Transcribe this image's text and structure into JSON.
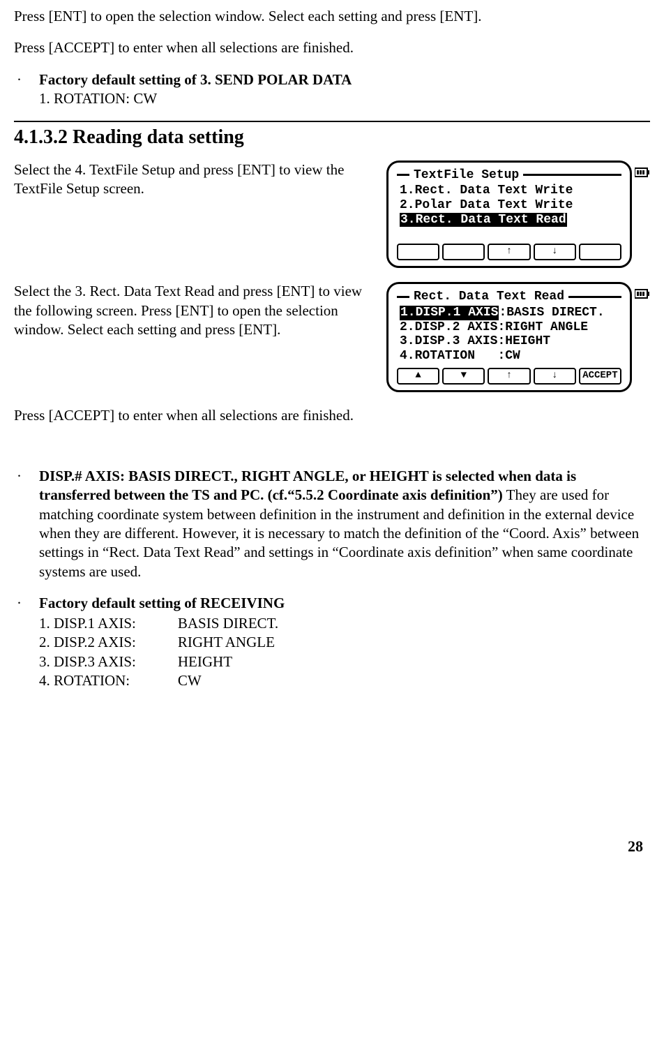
{
  "intro": {
    "p1": "Press [ENT] to open the selection window. Select each setting and press [ENT].",
    "p2": "Press [ACCEPT] to enter when all selections are finished."
  },
  "bullet1": {
    "title": "Factory default setting of 3. SEND POLAR DATA",
    "line1": "1. ROTATION: CW"
  },
  "section": {
    "heading": "4.1.3.2 Reading data setting",
    "p1": "Select the 4. TextFile Setup and press [ENT] to view the TextFile Setup screen.",
    "p2": "Select the 3. Rect. Data Text Read and press [ENT] to view the following screen. Press [ENT] to open the selection window. Select each setting and press [ENT].",
    "p3": "Press [ACCEPT] to enter when all selections are finished."
  },
  "lcd1": {
    "title": "TextFile Setup",
    "i1": "1.Rect. Data Text Write",
    "i2": "2.Polar Data Text Write",
    "i3": "3.Rect. Data Text Read",
    "soft": {
      "k1": "",
      "k2": "",
      "k3": "↑",
      "k4": "↓",
      "k5": ""
    }
  },
  "lcd2": {
    "title": "Rect. Data Text Read",
    "r1a": "1.DISP.1 AXIS",
    "r1b": ":BASIS DIRECT.",
    "r2a": "2.DISP.2 AXIS",
    "r2b": ":RIGHT ANGLE",
    "r3a": "3.DISP.3 AXIS",
    "r3b": ":HEIGHT",
    "r4a": "4.ROTATION   ",
    "r4b": ":CW",
    "soft": {
      "k1": "▲",
      "k2": "▼",
      "k3": "↑",
      "k4": "↓",
      "k5": "ACCEPT"
    }
  },
  "bullet2": {
    "title": "DISP.# AXIS: BASIS DIRECT., RIGHT ANGLE, or HEIGHT is selected when data is transferred between the TS and PC. (cf.“5.5.2 Coordinate axis definition”)",
    "body": "They are used for matching coordinate system between definition in the instrument and definition in the external device when they are different. However, it is necessary to match the definition of the “Coord. Axis” between settings in “Rect. Data Text Read” and settings in “Coordinate axis definition” when same coordinate systems are used."
  },
  "bullet3": {
    "title": "Factory default setting of RECEIVING",
    "rows": {
      "k1": "1. DISP.1 AXIS:",
      "v1": "BASIS DIRECT.",
      "k2": "2. DISP.2 AXIS:",
      "v2": "RIGHT ANGLE",
      "k3": "3. DISP.3 AXIS:",
      "v3": "HEIGHT",
      "k4": "4. ROTATION:",
      "v4": "CW"
    }
  },
  "pageNumber": "28"
}
